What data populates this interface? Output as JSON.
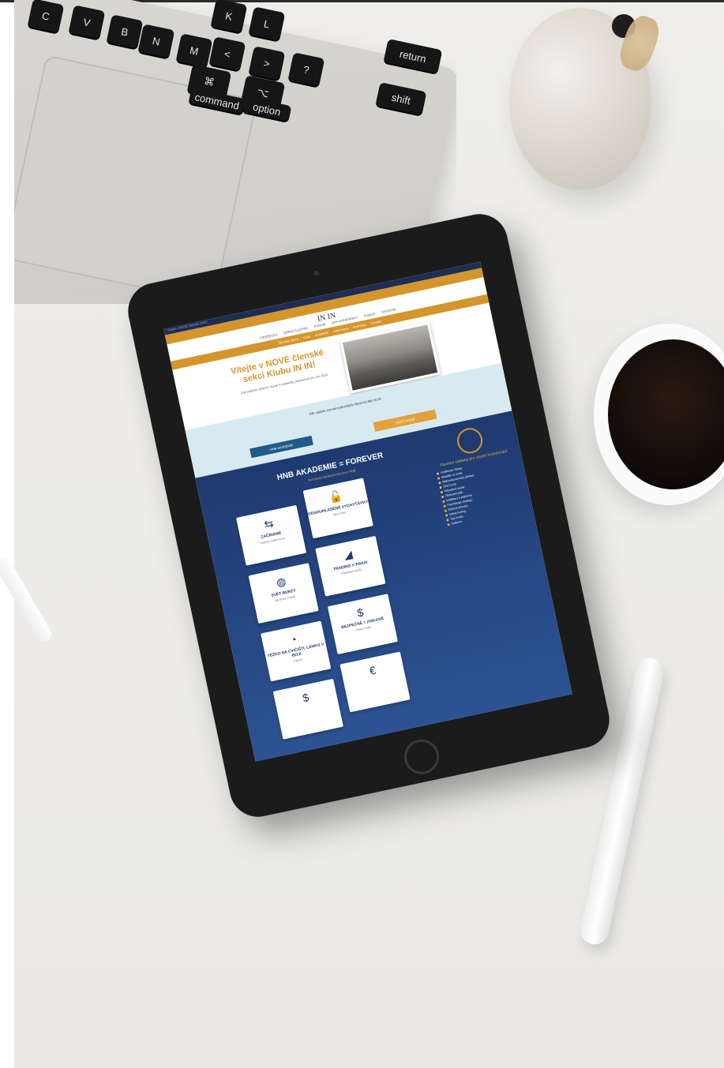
{
  "scene": {
    "laptop_keys": [
      "C",
      "V",
      "B",
      "N",
      "M",
      "K",
      "L",
      "<",
      ">",
      "?",
      "⌘",
      "⌥",
      "command",
      "option",
      "return",
      "shift"
    ]
  },
  "tablet": {
    "status_bar": "Vítejte v NOVÉ členské sekci",
    "site": {
      "logo": "IN IN",
      "top_links": [
        "FIREŠKOLA",
        "ZEBRA SLOVNÍK",
        "FORUM",
        "JAN KARAFINSKÝ",
        "Podcast",
        "ZIP/OKNA"
      ],
      "nav": [
        "Členská sekce",
        "Úvod",
        "Akademie",
        "Vaše kurzy",
        "Komunita",
        "Kontakt"
      ],
      "hero_title": "Vítejte v NOVÉ členské sekci Klubu IN IN!",
      "hero_sub": "Zde najdete veškerý obsah a materiály připravené pro rok 2024",
      "band_text": "Zde najdete seznam pokročilých členů KLUBU IN IN:",
      "btn_left": "HNB AKADEMIE",
      "btn_right": "ZAČÍT HRANÍ",
      "main_title": "HNB AKADEMIE = FOREVER",
      "main_sub": "Kompletní strukturovaný kurz HNB",
      "cards": [
        {
          "icon": "signpost-icon",
          "glyph": "⇆",
          "title": "ZAČÍNÁME",
          "desc": "Úvod do světa burzy"
        },
        {
          "icon": "lock-icon",
          "glyph": "🔓",
          "title": "ODSOUHLASENÉ VYCHYTÁVKY",
          "desc": "Tipy a triky"
        },
        {
          "icon": "globe-icon",
          "glyph": "◍",
          "title": "SVĚT BURZY",
          "desc": "Jak burzy vznikly"
        },
        {
          "icon": "chart-icon",
          "glyph": "◢",
          "title": "TRADING V PRAXI",
          "desc": "Případová studie"
        },
        {
          "icon": "pie-icon",
          "glyph": "◔",
          "title": "TĚŽKO NA CVIČIŠTI, LEHKO V BOJI",
          "desc": "Cvičení"
        },
        {
          "icon": "dollar-icon",
          "glyph": "$",
          "title": "BEZPEČNĚ = ZISKOVĚ",
          "desc": "Řízení rizika"
        },
        {
          "icon": "dollar-icon-2",
          "glyph": "$",
          "title": "",
          "desc": ""
        },
        {
          "icon": "euro-icon",
          "glyph": "€",
          "title": "",
          "desc": ""
        }
      ],
      "side_title": "Stavíme základy pro chytré investování",
      "side_items": [
        "Vzdělávací články",
        "Aktuality ze světa",
        "Makroekonomický přehled",
        "SACCLUB",
        "Případové studie",
        "Obchodní plán",
        "Indikátory a platformy",
        "Psychologie tradingu",
        "Daňové přiznání",
        "Swing trading",
        "Tipy a triky",
        "Software"
      ]
    }
  }
}
